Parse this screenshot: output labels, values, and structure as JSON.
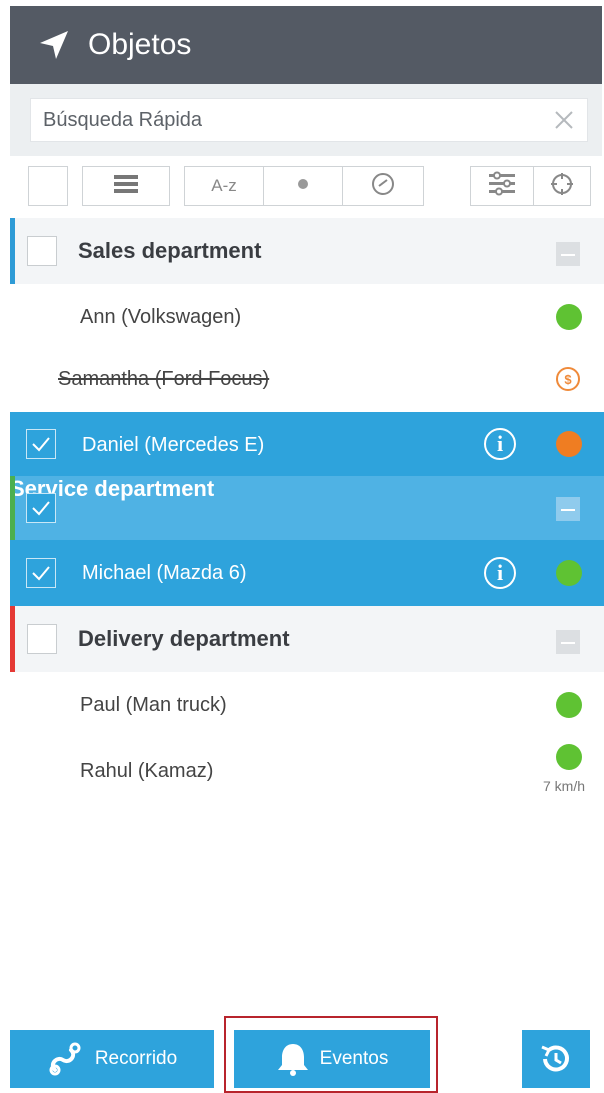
{
  "header": {
    "title": "Objetos",
    "icon": "navigation-arrow-icon"
  },
  "search": {
    "placeholder": "Búsqueda Rápida",
    "value": ""
  },
  "toolbar": {
    "sort_label": "A-z",
    "icons": [
      "select-all-checkbox",
      "list-view-icon",
      "sort-alpha",
      "status-dot-icon",
      "speedometer-icon",
      "filter-settings-icon",
      "crosshair-icon"
    ]
  },
  "objects": [
    {
      "type": "group",
      "label": "Sales department",
      "checked": false,
      "accent": "#2e9bd6"
    },
    {
      "type": "item",
      "label": "Ann (Volkswagen)",
      "status": "green"
    },
    {
      "type": "item",
      "label": "Samantha (Ford Focus)",
      "status": "parked",
      "strikethrough": true
    },
    {
      "type": "item",
      "label": "Daniel (Mercedes E)",
      "checked": true,
      "status": "orange",
      "info": "i"
    },
    {
      "type": "group",
      "label": "Service department",
      "checked": true,
      "accent": "#4caf50"
    },
    {
      "type": "item",
      "label": "Michael (Mazda 6)",
      "checked": true,
      "status": "green",
      "info": "i"
    },
    {
      "type": "group",
      "label": "Delivery department",
      "checked": false,
      "accent": "#e53935"
    },
    {
      "type": "item",
      "label": "Paul (Man truck)",
      "status": "green"
    },
    {
      "type": "item",
      "label": "Rahul (Kamaz)",
      "status": "green",
      "speed": "7 km/h"
    }
  ],
  "bottom": {
    "recorrido_label": "Recorrido",
    "eventos_label": "Eventos",
    "history_icon": "history-icon"
  },
  "colors": {
    "header": "#545a64",
    "accent": "#2ea3dc",
    "green": "#5fc233",
    "orange": "#ef7d22",
    "highlight": "#b8242c"
  }
}
